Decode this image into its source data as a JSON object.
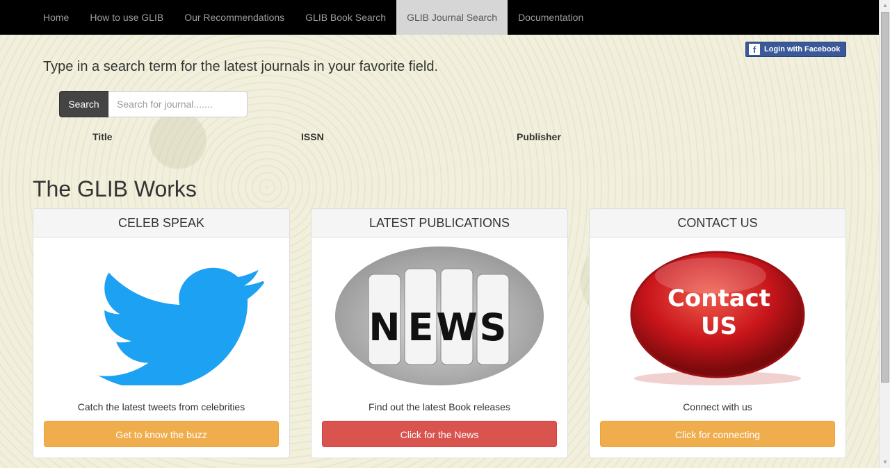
{
  "nav": {
    "items": [
      {
        "label": "Home"
      },
      {
        "label": "How to use GLIB"
      },
      {
        "label": "Our Recommendations"
      },
      {
        "label": "GLIB Book Search"
      },
      {
        "label": "GLIB Journal Search"
      },
      {
        "label": "Documentation"
      }
    ],
    "active_index": 4
  },
  "facebook": {
    "label": "Login with Facebook",
    "icon": "facebook-icon",
    "color": "#3b5998"
  },
  "headline": "Type in a search term for the latest journals in your favorite field.",
  "search": {
    "button_label": "Search",
    "placeholder": "Search for journal.......",
    "value": ""
  },
  "results_columns": [
    "Title",
    "ISSN",
    "Publisher"
  ],
  "section_title": "The GLIB Works",
  "cards": [
    {
      "title": "CELEB SPEAK",
      "image": "twitter-bird-icon",
      "text": "Catch the latest tweets from celebrities",
      "button": "Get to know the buzz",
      "button_color": "#f0ad4e"
    },
    {
      "title": "LATEST PUBLICATIONS",
      "image": "news-dice-image",
      "image_text": "NEWS",
      "text": "Find out the latest Book releases",
      "button": "Click for the News",
      "button_color": "#d9534f"
    },
    {
      "title": "CONTACT US",
      "image": "contact-us-button-image",
      "image_text": [
        "Contact",
        "US"
      ],
      "text": "Connect with us",
      "button": "Click for connecting",
      "button_color": "#f0ad4e"
    }
  ]
}
